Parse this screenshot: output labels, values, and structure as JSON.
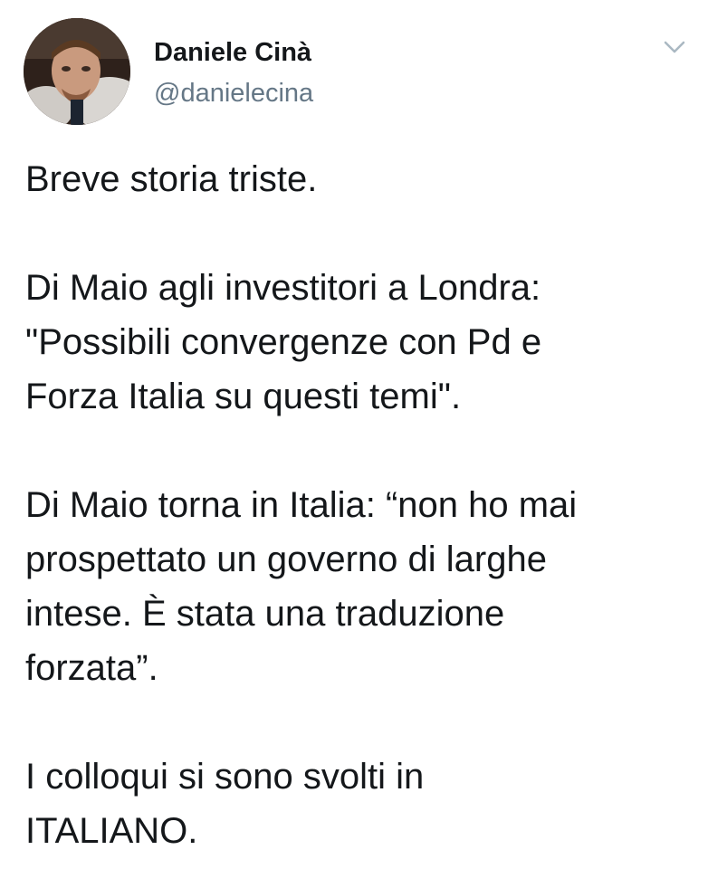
{
  "tweet": {
    "author": {
      "name": "Daniele Cinà",
      "handle": "@danielecina"
    },
    "menu_icon": "chevron-down-icon",
    "paragraphs": [
      [
        "Breve storia triste."
      ],
      [
        "Di Maio agli investitori a Londra:",
        "\"Possibili convergenze con Pd e",
        "Forza Italia su questi temi\"."
      ],
      [
        "Di Maio torna in Italia: “non ho mai",
        "prospettato un governo di larghe",
        "intese. È stata una traduzione",
        "forzata”."
      ],
      [
        "I colloqui si sono svolti in",
        "ITALIANO."
      ]
    ]
  },
  "colors": {
    "text": "#14171a",
    "secondary": "#657786",
    "chevron": "#aab8c2"
  }
}
